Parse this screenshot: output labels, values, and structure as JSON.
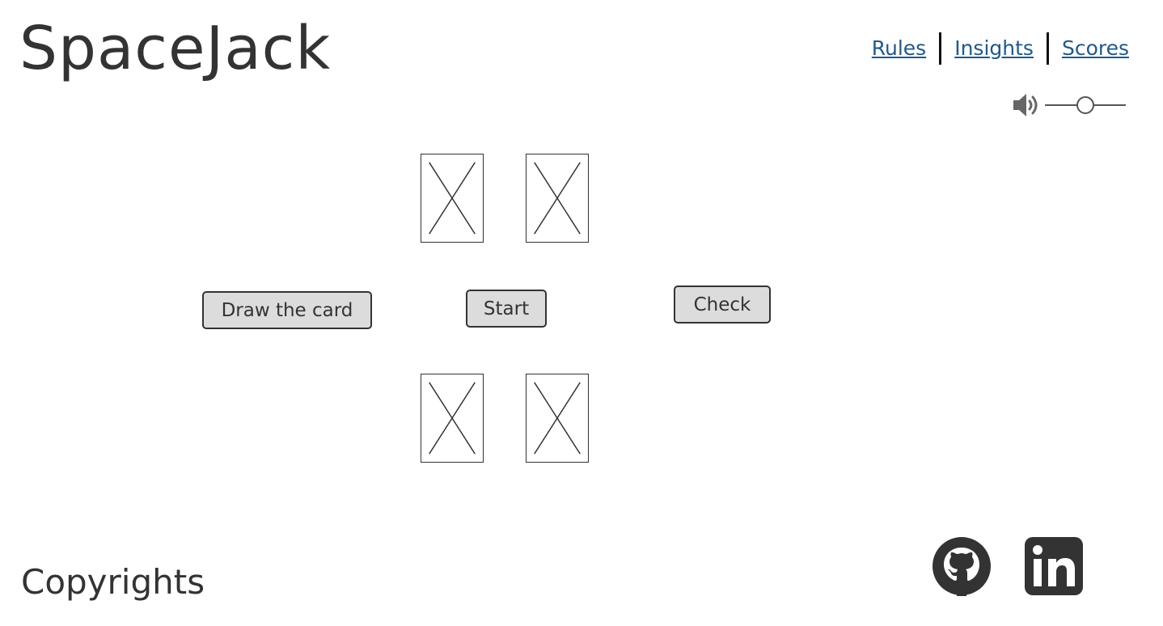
{
  "header": {
    "title": "SpaceJack",
    "nav": [
      {
        "label": "Rules"
      },
      {
        "label": "Insights"
      },
      {
        "label": "Scores"
      }
    ]
  },
  "volume": {
    "icon": "speaker-icon",
    "level": 0.5
  },
  "table": {
    "dealer_cards": [
      {
        "state": "placeholder"
      },
      {
        "state": "placeholder"
      }
    ],
    "player_cards": [
      {
        "state": "placeholder"
      },
      {
        "state": "placeholder"
      }
    ]
  },
  "controls": {
    "draw_label": "Draw the card",
    "start_label": "Start",
    "check_label": "Check"
  },
  "footer": {
    "copyright": "Copyrights",
    "links": [
      {
        "icon": "github-icon"
      },
      {
        "icon": "linkedin-icon"
      }
    ]
  },
  "colors": {
    "text": "#333333",
    "link": "#1f5a8c",
    "button_bg": "#dcdcdc",
    "border": "#333333"
  }
}
